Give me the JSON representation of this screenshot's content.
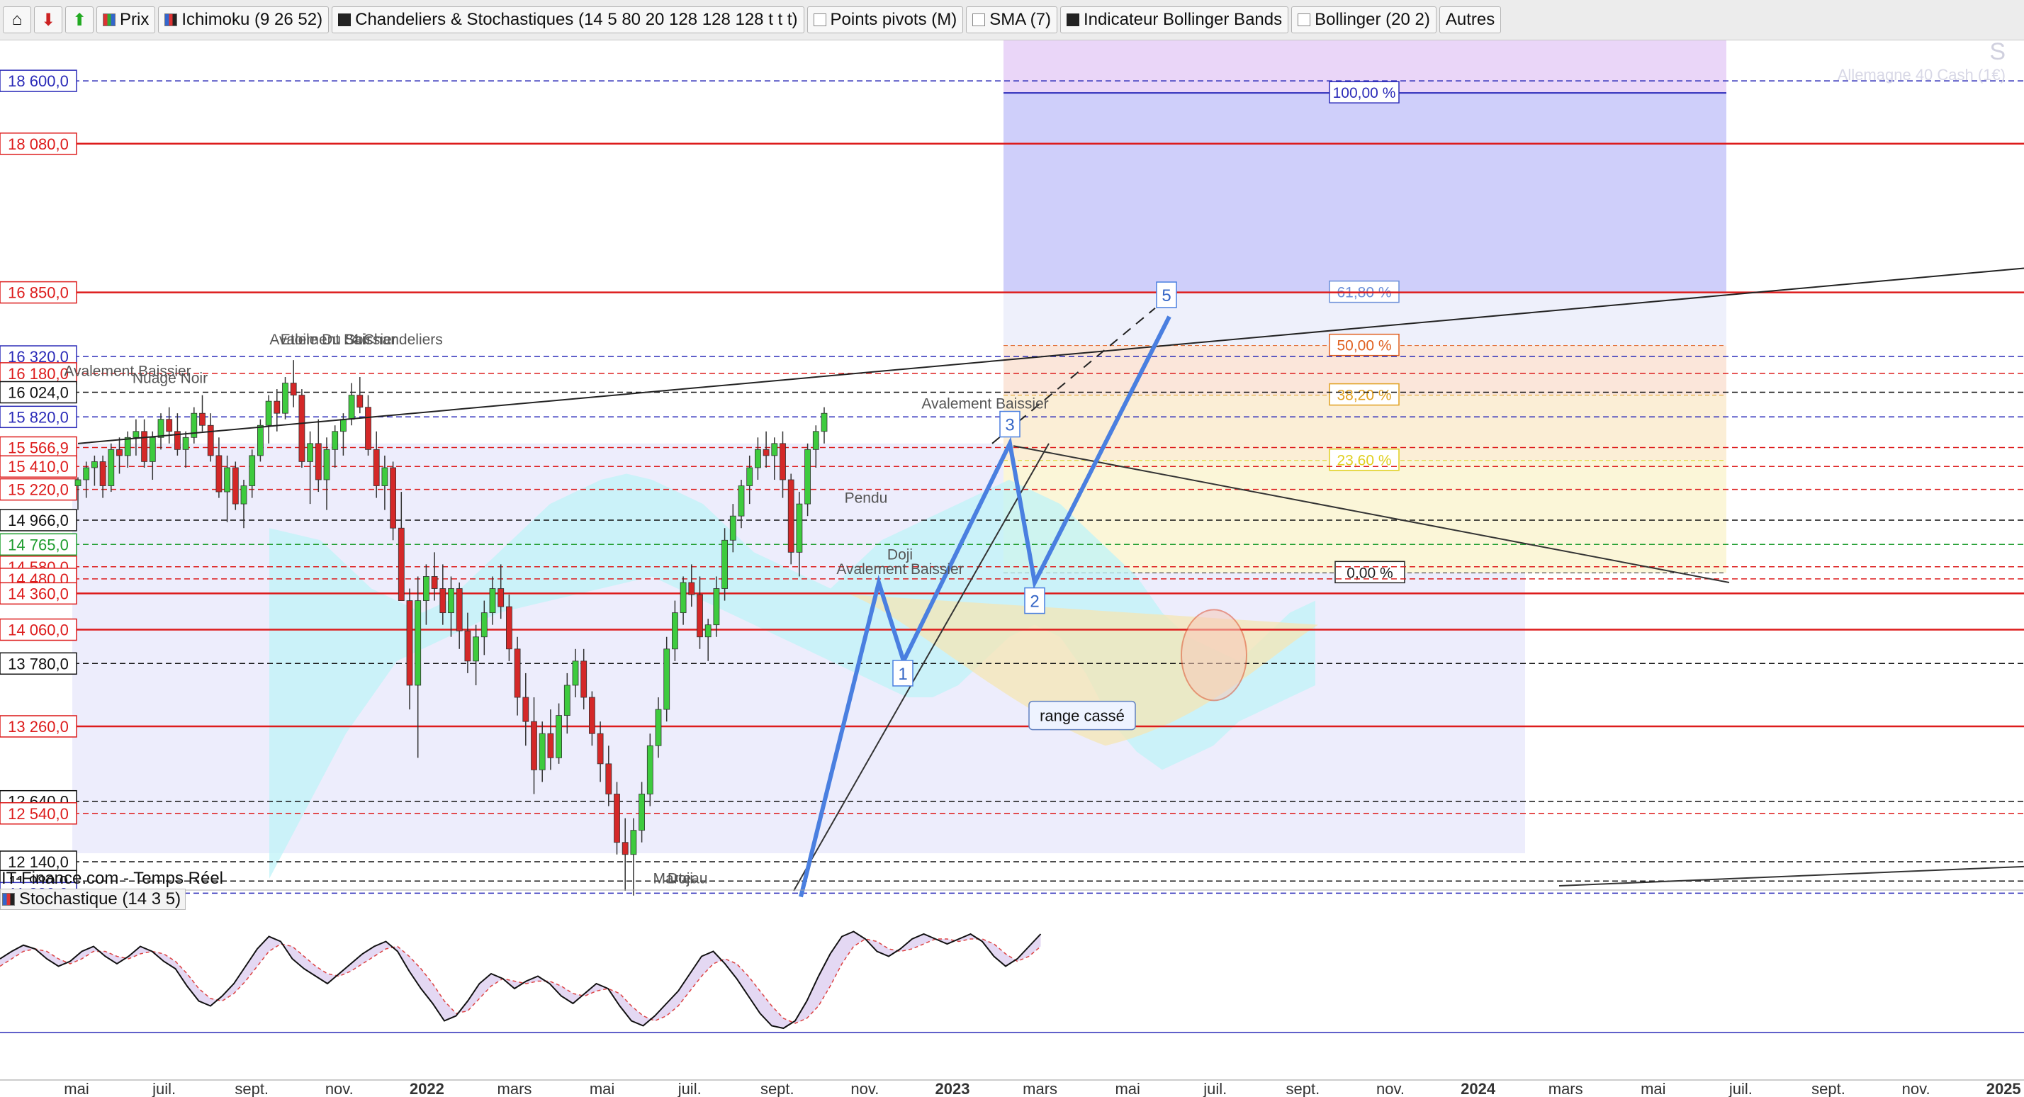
{
  "toolbar": {
    "items": [
      {
        "label": "Prix",
        "check": "colored"
      },
      {
        "label": "Ichimoku (9 26 52)",
        "check": "multi"
      },
      {
        "label": "Chandeliers & Stochastiques (14 5 80 20 128 128 128 t t t)",
        "check": "on"
      },
      {
        "label": "Points pivots (M)",
        "check": "off"
      },
      {
        "label": "SMA (7)",
        "check": "off"
      },
      {
        "label": "Indicateur Bollinger Bands",
        "check": "on"
      },
      {
        "label": "Bollinger (20 2)",
        "check": "off"
      },
      {
        "label": "Autres",
        "check": "none"
      }
    ]
  },
  "source_label": "IT-Finance.com - Temps Réel",
  "watermark": {
    "symbol": "S",
    "name": "Allemagne 40 Cash (1€)"
  },
  "stoch_label": "Stochastique (14 3 5)",
  "colors": {
    "red": "#dd1c1c",
    "blue": "#2b2bb8",
    "black": "#111111",
    "green": "#1f9d2f",
    "cloud": "#bff3f8",
    "fib": "#c9c9f6",
    "trend_blue": "#4a7fe0"
  },
  "chart_data": {
    "type": "candlestick",
    "instrument": "Allemagne 40 Cash (1€)",
    "yscale": "linear",
    "ylim": [
      11800,
      18800
    ],
    "x_ticks": [
      "mai",
      "juil.",
      "sept.",
      "nov.",
      "2022",
      "mars",
      "mai",
      "juil.",
      "sept.",
      "nov.",
      "2023",
      "mars",
      "mai",
      "juil.",
      "sept.",
      "nov.",
      "2024",
      "mars",
      "mai",
      "juil.",
      "sept.",
      "nov.",
      "2025"
    ],
    "levels": [
      {
        "value": 18600,
        "label": "18 600,0",
        "color": "blue"
      },
      {
        "value": 18080,
        "label": "18 080,0",
        "color": "red"
      },
      {
        "value": 16850,
        "label": "16 850,0",
        "color": "red"
      },
      {
        "value": 16320,
        "label": "16 320,0",
        "color": "blue"
      },
      {
        "value": 16180,
        "label": "16 180,0",
        "color": "red"
      },
      {
        "value": 16024,
        "label": "16 024,0",
        "color": "black"
      },
      {
        "value": 15820,
        "label": "15 820,0",
        "color": "blue"
      },
      {
        "value": 15566.9,
        "label": "15 566,9",
        "color": "red"
      },
      {
        "value": 15410,
        "label": "15 410,0",
        "color": "red"
      },
      {
        "value": 15220,
        "label": "15 220,0",
        "color": "red"
      },
      {
        "value": 14966,
        "label": "14 966,0",
        "color": "black"
      },
      {
        "value": 14765,
        "label": "14 765,0",
        "color": "green"
      },
      {
        "value": 14580,
        "label": "14 580,0",
        "color": "red"
      },
      {
        "value": 14480,
        "label": "14 480,0",
        "color": "red"
      },
      {
        "value": 14360,
        "label": "14 360,0",
        "color": "red"
      },
      {
        "value": 14060,
        "label": "14 060,0",
        "color": "red"
      },
      {
        "value": 13780,
        "label": "13 780,0",
        "color": "black"
      },
      {
        "value": 13260,
        "label": "13 260,0",
        "color": "red"
      },
      {
        "value": 12640,
        "label": "12 640,0",
        "color": "black"
      },
      {
        "value": 12540,
        "label": "12 540,0",
        "color": "red"
      },
      {
        "value": 12140,
        "label": "12 140,0",
        "color": "black"
      },
      {
        "value": 11980,
        "label": "11 980,0",
        "color": "black"
      },
      {
        "value": 11880,
        "label": "11 880,0",
        "color": "blue"
      }
    ],
    "fibonacci": [
      {
        "label": "100,00 %",
        "color": "#2b2bb8"
      },
      {
        "label": "61,80 %",
        "color": "#6a8fd8"
      },
      {
        "label": "50,00 %",
        "color": "#e06020"
      },
      {
        "label": "38,20 %",
        "color": "#e0a020"
      },
      {
        "label": "23,60 %",
        "color": "#e0d020"
      },
      {
        "label": "0,00 %",
        "color": "#222222"
      }
    ],
    "fibonacci_values": [
      18500,
      16850,
      16410,
      16000,
      15460,
      14530
    ],
    "wave_labels": [
      "1",
      "2",
      "3",
      "5"
    ],
    "annotations": {
      "range": "range cassé",
      "patterns": [
        "Etoile Du Soir",
        "Avalement Baissier",
        "4 Chandeliers",
        "Nuage Noir",
        "Avalement Baissier",
        "Avalement Baissier",
        "Pendu",
        "Doji",
        "Avalement Baissier",
        "Marteau",
        "Doji"
      ]
    },
    "candles": {
      "start": "2021-04",
      "interval": "1 semaine",
      "values": [
        [
          15250,
          15320,
          15050,
          15300
        ],
        [
          15300,
          15450,
          15150,
          15400
        ],
        [
          15400,
          15500,
          15250,
          15450
        ],
        [
          15450,
          15500,
          15150,
          15250
        ],
        [
          15250,
          15600,
          15200,
          15550
        ],
        [
          15550,
          15650,
          15350,
          15500
        ],
        [
          15500,
          15700,
          15400,
          15650
        ],
        [
          15650,
          15800,
          15500,
          15700
        ],
        [
          15700,
          15800,
          15400,
          15450
        ],
        [
          15450,
          15700,
          15300,
          15650
        ],
        [
          15650,
          15850,
          15550,
          15800
        ],
        [
          15800,
          15900,
          15600,
          15700
        ],
        [
          15700,
          15850,
          15500,
          15550
        ],
        [
          15550,
          15700,
          15400,
          15650
        ],
        [
          15650,
          15900,
          15600,
          15850
        ],
        [
          15850,
          16000,
          15700,
          15750
        ],
        [
          15750,
          15850,
          15450,
          15500
        ],
        [
          15500,
          15650,
          15150,
          15200
        ],
        [
          15200,
          15500,
          14950,
          15400
        ],
        [
          15400,
          15450,
          15050,
          15100
        ],
        [
          15100,
          15300,
          14900,
          15250
        ],
        [
          15250,
          15550,
          15150,
          15500
        ],
        [
          15500,
          15800,
          15450,
          15750
        ],
        [
          15750,
          16000,
          15600,
          15950
        ],
        [
          15950,
          16050,
          15700,
          15850
        ],
        [
          15850,
          16150,
          15800,
          16100
        ],
        [
          16100,
          16290,
          15900,
          16000
        ],
        [
          16000,
          16050,
          15400,
          15450
        ],
        [
          15450,
          15700,
          15100,
          15600
        ],
        [
          15600,
          15800,
          15200,
          15300
        ],
        [
          15300,
          15650,
          15050,
          15550
        ],
        [
          15550,
          15750,
          15400,
          15700
        ],
        [
          15700,
          15850,
          15500,
          15800
        ],
        [
          15800,
          16100,
          15750,
          16000
        ],
        [
          16000,
          16150,
          15850,
          15900
        ],
        [
          15900,
          16000,
          15500,
          15550
        ],
        [
          15550,
          15700,
          15150,
          15250
        ],
        [
          15250,
          15500,
          15050,
          15400
        ],
        [
          15400,
          15450,
          14800,
          14900
        ],
        [
          14900,
          15200,
          14700,
          14300
        ],
        [
          14300,
          14400,
          13400,
          13600
        ],
        [
          13600,
          14500,
          13000,
          14300
        ],
        [
          14300,
          14600,
          14100,
          14500
        ],
        [
          14500,
          14700,
          14300,
          14400
        ],
        [
          14400,
          14600,
          14100,
          14200
        ],
        [
          14200,
          14500,
          14000,
          14400
        ],
        [
          14400,
          14450,
          13900,
          14050
        ],
        [
          14050,
          14200,
          13700,
          13800
        ],
        [
          13800,
          14100,
          13600,
          14000
        ],
        [
          14000,
          14300,
          13850,
          14200
        ],
        [
          14200,
          14500,
          14100,
          14400
        ],
        [
          14400,
          14600,
          14150,
          14250
        ],
        [
          14250,
          14350,
          13800,
          13900
        ],
        [
          13900,
          14000,
          13350,
          13500
        ],
        [
          13500,
          13700,
          13100,
          13300
        ],
        [
          13300,
          13500,
          12700,
          12900
        ],
        [
          12900,
          13300,
          12800,
          13200
        ],
        [
          13200,
          13400,
          12900,
          13000
        ],
        [
          13000,
          13450,
          12950,
          13350
        ],
        [
          13350,
          13700,
          13200,
          13600
        ],
        [
          13600,
          13900,
          13500,
          13800
        ],
        [
          13800,
          13900,
          13400,
          13500
        ],
        [
          13500,
          13550,
          13100,
          13200
        ],
        [
          13200,
          13300,
          12800,
          12950
        ],
        [
          12950,
          13100,
          12600,
          12700
        ],
        [
          12700,
          12800,
          12200,
          12300
        ],
        [
          12300,
          12500,
          11900,
          12200
        ],
        [
          12200,
          12500,
          11860,
          12400
        ],
        [
          12400,
          12800,
          12300,
          12700
        ],
        [
          12700,
          13200,
          12600,
          13100
        ],
        [
          13100,
          13500,
          13000,
          13400
        ],
        [
          13400,
          14000,
          13300,
          13900
        ],
        [
          13900,
          14300,
          13800,
          14200
        ],
        [
          14200,
          14500,
          14100,
          14450
        ],
        [
          14450,
          14600,
          14250,
          14350
        ],
        [
          14350,
          14500,
          13900,
          14000
        ],
        [
          14000,
          14150,
          13800,
          14100
        ],
        [
          14100,
          14500,
          14000,
          14400
        ],
        [
          14400,
          14900,
          14300,
          14800
        ],
        [
          14800,
          15100,
          14700,
          15000
        ],
        [
          15000,
          15300,
          14900,
          15250
        ],
        [
          15250,
          15500,
          15100,
          15400
        ],
        [
          15400,
          15650,
          15300,
          15550
        ],
        [
          15550,
          15700,
          15400,
          15500
        ],
        [
          15500,
          15650,
          15300,
          15600
        ],
        [
          15600,
          15700,
          15150,
          15300
        ],
        [
          15300,
          15350,
          14600,
          14700
        ],
        [
          14700,
          15200,
          14500,
          15100
        ],
        [
          15100,
          15600,
          15000,
          15550
        ],
        [
          15550,
          15750,
          15400,
          15700
        ],
        [
          15700,
          15900,
          15600,
          15850
        ]
      ]
    },
    "stochastic": {
      "ylim": [
        0,
        100
      ],
      "k": [
        64,
        70,
        75,
        72,
        64,
        58,
        62,
        70,
        74,
        66,
        60,
        66,
        74,
        70,
        62,
        56,
        42,
        30,
        26,
        34,
        44,
        58,
        72,
        82,
        78,
        64,
        56,
        50,
        44,
        52,
        60,
        68,
        74,
        78,
        70,
        54,
        40,
        28,
        14,
        18,
        30,
        44,
        52,
        48,
        40,
        46,
        50,
        44,
        34,
        28,
        36,
        44,
        40,
        26,
        14,
        10,
        18,
        28,
        38,
        52,
        66,
        70,
        60,
        48,
        34,
        20,
        10,
        8,
        14,
        30,
        50,
        68,
        82,
        86,
        80,
        70,
        66,
        72,
        80,
        84,
        80,
        76,
        80,
        84,
        78,
        66,
        58,
        64,
        74,
        84
      ],
      "d": [
        58,
        64,
        70,
        72,
        70,
        64,
        60,
        64,
        70,
        70,
        66,
        64,
        68,
        70,
        68,
        62,
        52,
        40,
        32,
        30,
        36,
        46,
        58,
        70,
        76,
        74,
        66,
        58,
        52,
        50,
        54,
        60,
        66,
        72,
        74,
        66,
        56,
        44,
        30,
        20,
        22,
        32,
        42,
        48,
        46,
        44,
        46,
        46,
        42,
        36,
        34,
        38,
        40,
        36,
        26,
        18,
        14,
        18,
        26,
        38,
        50,
        60,
        64,
        60,
        50,
        38,
        26,
        16,
        12,
        16,
        26,
        42,
        60,
        74,
        80,
        78,
        72,
        70,
        72,
        76,
        80,
        80,
        78,
        80,
        80,
        76,
        68,
        62,
        66,
        74
      ]
    }
  }
}
